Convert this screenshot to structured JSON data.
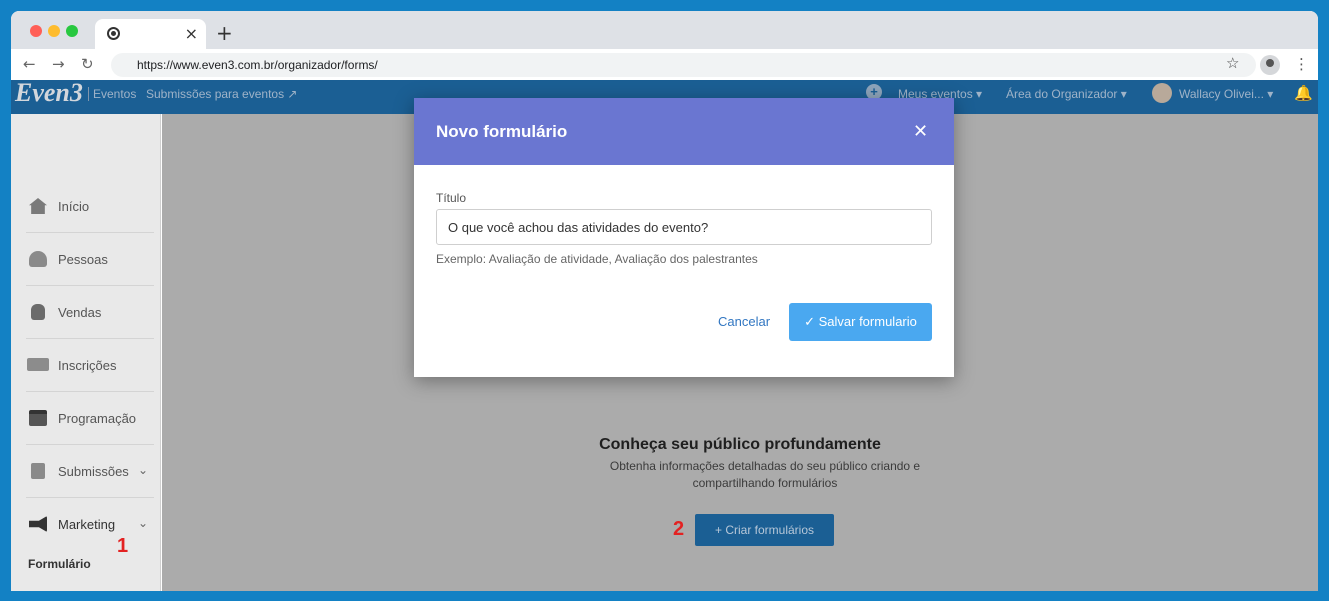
{
  "browser": {
    "tab_close": "×",
    "new_tab": "+",
    "url": "https://www.even3.com.br/organizador/forms/"
  },
  "header": {
    "logo": "Even3",
    "nav_events": "Eventos",
    "nav_submissions": "Submissões para eventos ↗",
    "my_events": "Meus eventos ▾",
    "organizer_area": "Área do Organizador ▾",
    "user_name": "Wallacy Olivei... ▾"
  },
  "sidebar": {
    "items": [
      {
        "label": "Início",
        "icon": "home-icon",
        "color": "#7a7a7a"
      },
      {
        "label": "Pessoas",
        "icon": "people-icon",
        "color": "#8a8a8a"
      },
      {
        "label": "Vendas",
        "icon": "money-bag-icon",
        "color": "#6b6b6b"
      },
      {
        "label": "Inscrições",
        "icon": "ticket-icon",
        "color": "#8c8c8c"
      },
      {
        "label": "Programação",
        "icon": "calendar-icon",
        "color": "#555555"
      },
      {
        "label": "Submissões",
        "icon": "document-icon",
        "color": "#8a8a8a",
        "chevron": "⌄"
      },
      {
        "label": "Marketing",
        "icon": "megaphone-icon",
        "color": "#333333",
        "chevron": "⌄"
      }
    ],
    "sub_item": "Formulário"
  },
  "main": {
    "title": "Conheça seu público profundamente",
    "description": "Obtenha informações detalhadas do seu público criando e compartilhando formulários",
    "create_button": "+ Criar formulários",
    "badge_1": "1",
    "badge_2": "2"
  },
  "modal": {
    "title": "Novo formulário",
    "close": "✕",
    "field_label": "Título",
    "field_value": "O que você achou das atividades do evento?",
    "help_text": "Exemplo: Avaliação de atividade, Avaliação dos palestrantes",
    "cancel": "Cancelar",
    "save": "✓  Salvar formulario"
  }
}
